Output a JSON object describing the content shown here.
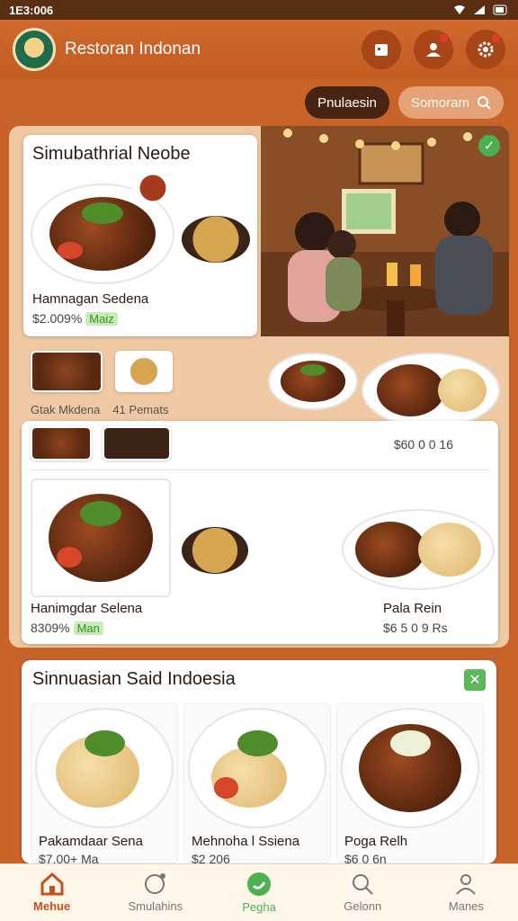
{
  "status_bar": {
    "time": "1E3:006"
  },
  "header": {
    "title": "Restoran Indonan"
  },
  "chips": {
    "dark": "Pnulaesin",
    "light": "Somoram"
  },
  "featured": {
    "title": "Simubathrial Neobe",
    "dish": "Hamnagan Sedena",
    "price": "$2.009%",
    "badge": "Maiz"
  },
  "thumb_labels": {
    "left": "Gtak Mkdena",
    "right": "41 Pemats"
  },
  "list_card": {
    "top_price": "$60 0 0 16",
    "left_dish": "Hanimgdar Selena",
    "left_price": "8309%",
    "left_badge": "Man",
    "right_dish": "Pala Rein",
    "right_price": "$6 5 0 9 Rs"
  },
  "section": {
    "title": "Sinnuasian Said Indoesia",
    "items": [
      {
        "name": "Pakamdaar Sena",
        "price": "$7.00+ Ma"
      },
      {
        "name": "Mehnoha l Ssiena",
        "price": "$2 206"
      },
      {
        "name": "Poga Relh",
        "price": "$6 0 6n"
      }
    ]
  },
  "nav": {
    "items": [
      {
        "label": "Mehue",
        "icon": "home-icon"
      },
      {
        "label": "Smulahins",
        "icon": "chat-icon"
      },
      {
        "label": "Pegha",
        "icon": "message-icon"
      },
      {
        "label": "Gelonn",
        "icon": "search-icon"
      },
      {
        "label": "Manes",
        "icon": "profile-icon"
      }
    ]
  },
  "colors": {
    "brand": "#c8642a",
    "header": "#c25a22",
    "accent_green": "#4caf50"
  }
}
